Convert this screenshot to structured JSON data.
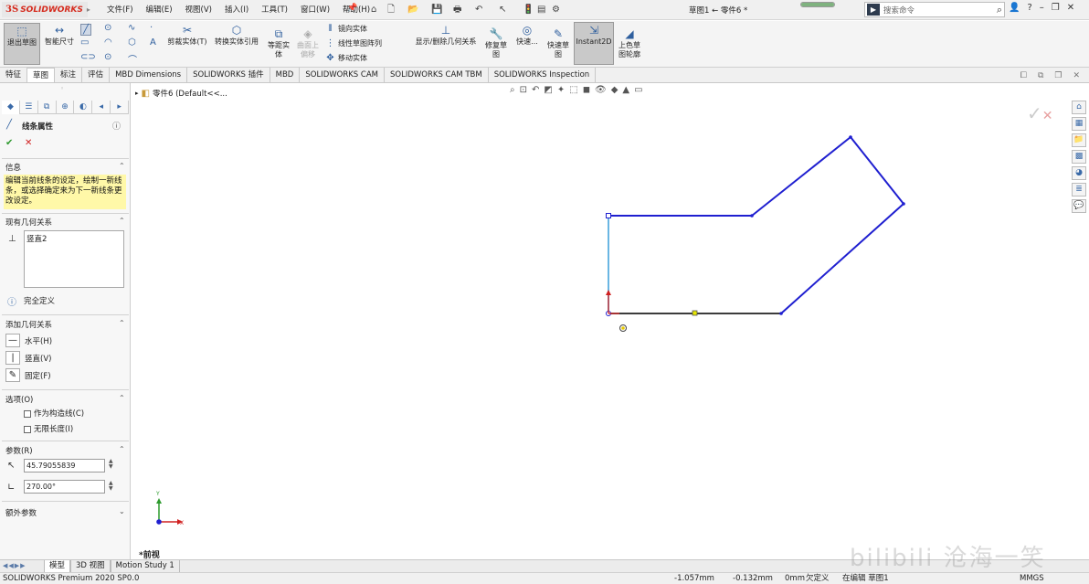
{
  "app": {
    "logo_ds": "3S",
    "logo_name": "SOLIDWORKS",
    "doc_title": "草图1 ← 零件6 *"
  },
  "menu": [
    "文件(F)",
    "编辑(E)",
    "视图(V)",
    "插入(I)",
    "工具(T)",
    "窗口(W)",
    "帮助(H)"
  ],
  "search": {
    "placeholder": "搜索命令"
  },
  "progress": {
    "value_pct": 100
  },
  "toolbar": {
    "exit_sketch": "退出草图",
    "smart_dimension": "智能尺寸",
    "trim": "剪裁实体(T)",
    "convert": "转换实体引用",
    "offset": "等距实体",
    "surface_offset": "曲面上偏移",
    "mirror": "镜向实体",
    "linear_pattern": "线性草图阵列",
    "move": "移动实体",
    "display_relations": "显示/删除几何关系",
    "repair": "修复草图",
    "quick_snaps": "快速...",
    "rapid_sketch": "快速草图",
    "instant2d": "Instant2D",
    "shaded_contours": "上色草图轮廓"
  },
  "tabs": [
    "特征",
    "草图",
    "标注",
    "评估",
    "MBD Dimensions",
    "SOLIDWORKS 插件",
    "MBD",
    "SOLIDWORKS CAM",
    "SOLIDWORKS CAM TBM",
    "SOLIDWORKS Inspection"
  ],
  "active_tab": "草图",
  "property_manager": {
    "title": "线条属性",
    "info_title": "信息",
    "info_text": "编辑当前线条的设定，绘制一新线条，或选择确定来为下一新线条更改设定。",
    "existing_relations_title": "现有几何关系",
    "existing_relation_item": "竖直2",
    "status": "完全定义",
    "add_relations_title": "添加几何关系",
    "add_relations": [
      "水平(H)",
      "竖直(V)",
      "固定(F)"
    ],
    "options_title": "选项(O)",
    "options": [
      "作为构造线(C)",
      "无限长度(I)"
    ],
    "params_title": "参数(R)",
    "length_value": "45.79055839",
    "angle_value": "270.00°",
    "extra_params_title": "额外参数"
  },
  "graphics": {
    "tree_root": "零件6 (Default<<...",
    "view_label": "*前视",
    "axis_y": "Y",
    "axis_x": "X"
  },
  "bottom_tabs": [
    "模型",
    "3D 视图",
    "Motion Study 1"
  ],
  "active_bottom_tab": "模型",
  "status": {
    "product": "SOLIDWORKS Premium 2020 SP0.0",
    "x": "-1.057mm",
    "y": "-0.132mm",
    "z": "0mm",
    "definition": "欠定义",
    "editing": "在编辑 草图1",
    "units": "MMGS"
  },
  "watermark": "bilibili 沧海一笑",
  "colors": {
    "sketch_line": "#1f1fd0",
    "selected_line": "#5aaee0",
    "info_bg": "#fff8a8",
    "check_green": "#2e9a2e",
    "cross_red": "#d02020"
  }
}
